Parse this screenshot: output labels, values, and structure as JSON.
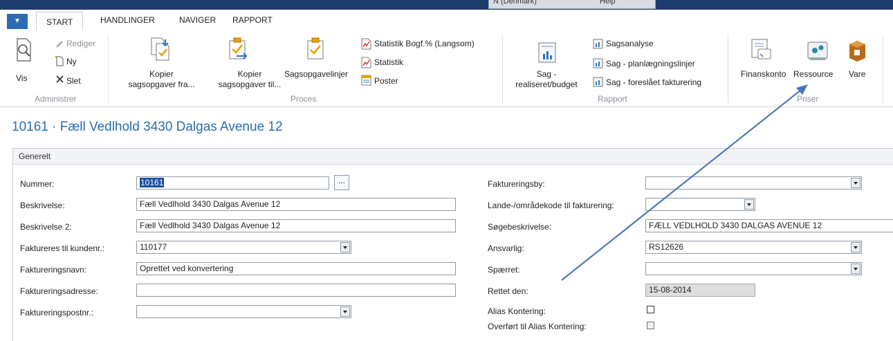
{
  "titlebar": {
    "center_text": "N (Denmark)",
    "help_label": "Help"
  },
  "tabs": [
    "START",
    "HANDLINGER",
    "NAVIGER",
    "RAPPORT"
  ],
  "ribbon": {
    "administrer": {
      "label": "Administrer",
      "vis": "Vis",
      "rediger": "Rediger",
      "ny": "Ny",
      "slet": "Slet"
    },
    "proces": {
      "label": "Proces",
      "kopier_fra_1": "Kopier",
      "kopier_fra_2": "sagsopgaver fra...",
      "kopier_til_1": "Kopier",
      "kopier_til_2": "sagsopgaver til...",
      "sagsopgavelinjer": "Sagsopgavelinjer",
      "statistik_bogf": "Statistik Bogf.% (Langsom)",
      "statistik": "Statistik",
      "poster": "Poster"
    },
    "rapport": {
      "label": "Rapport",
      "sag_1": "Sag -",
      "sag_2": "realiseret/budget",
      "sagsanalyse": "Sagsanalyse",
      "planlaegning": "Sag - planlægningslinjer",
      "foreslaaet": "Sag - foreslået fakturering"
    },
    "priser": {
      "label": "Priser",
      "finanskonto": "Finanskonto",
      "ressource": "Ressource",
      "vare": "Vare"
    }
  },
  "page_title": "10161 · Fæll Vedlhold 3430 Dalgas Avenue 12",
  "card": {
    "header": "Generelt",
    "left": [
      {
        "label": "Nummer:",
        "value": "10161"
      },
      {
        "label": "Beskrivelse:",
        "value": "Fæll Vedlhold 3430 Dalgas Avenue 12"
      },
      {
        "label": "Beskrivelse 2:",
        "value": "Fæll Vedlhold 3430 Dalgas Avenue 12"
      },
      {
        "label": "Faktureres til kundenr.:",
        "value": "110177"
      },
      {
        "label": "Faktureringsnavn:",
        "value": "Oprettet ved konvertering"
      },
      {
        "label": "Faktureringsadresse:",
        "value": ""
      },
      {
        "label": "Faktureringspostnr.:",
        "value": ""
      }
    ],
    "right": [
      {
        "label": "Faktureringsby:",
        "value": ""
      },
      {
        "label": "Lande-/områdekode til fakturering:",
        "value": ""
      },
      {
        "label": "Søgebeskrivelse:",
        "value": "FÆLL VEDLHOLD 3430 DALGAS AVENUE 12"
      },
      {
        "label": "Ansvarlig:",
        "value": "RS12626"
      },
      {
        "label": "Spærret:",
        "value": ""
      },
      {
        "label": "Rettet den:",
        "value": "15-08-2014"
      },
      {
        "label": "Alias Kontering:",
        "value": false
      },
      {
        "label": "Overført til Alias Kontering:",
        "value": false
      }
    ],
    "assist_label": "..."
  },
  "colors": {
    "accent": "#2a6db0",
    "topbar": "#1e3b6e",
    "arrow": "#4a78b8"
  }
}
